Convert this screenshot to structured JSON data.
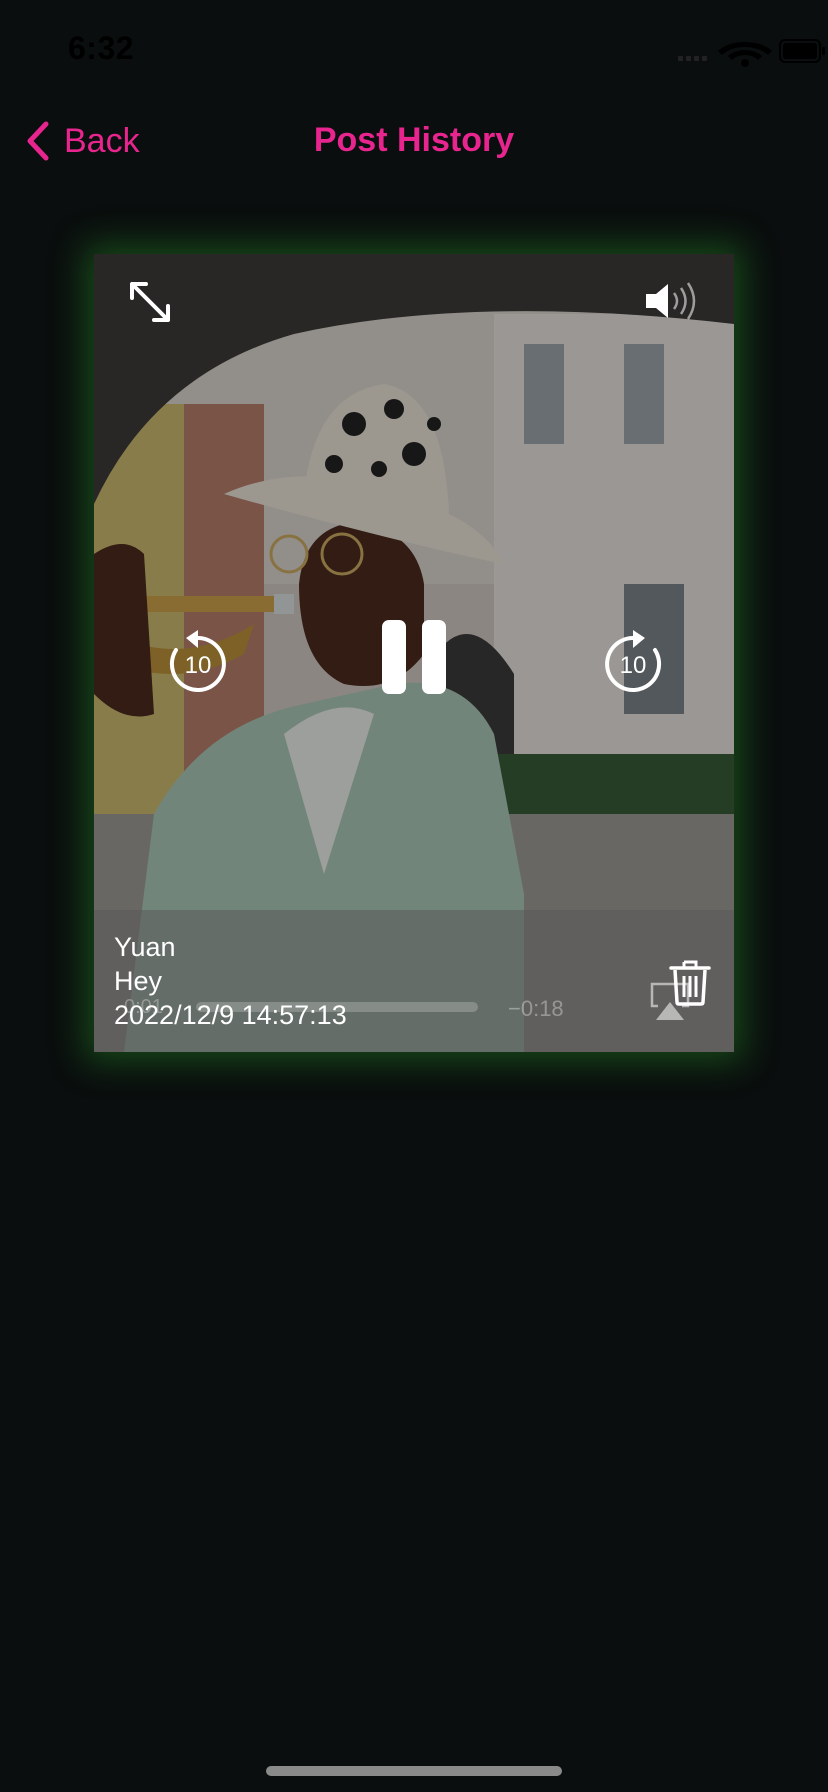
{
  "status_bar": {
    "time": "6:32"
  },
  "nav": {
    "back_label": "Back",
    "title": "Post History"
  },
  "player": {
    "skip_back_seconds": "10",
    "skip_forward_seconds": "10",
    "time_elapsed": "0:01",
    "time_remaining": "−0:18"
  },
  "post": {
    "author": "Yuan",
    "message": "Hey",
    "timestamp": "2022/12/9 14:57:13"
  },
  "colors": {
    "accent": "#e8258e",
    "background": "#0a0e0e",
    "card_glow": "#288c28"
  }
}
